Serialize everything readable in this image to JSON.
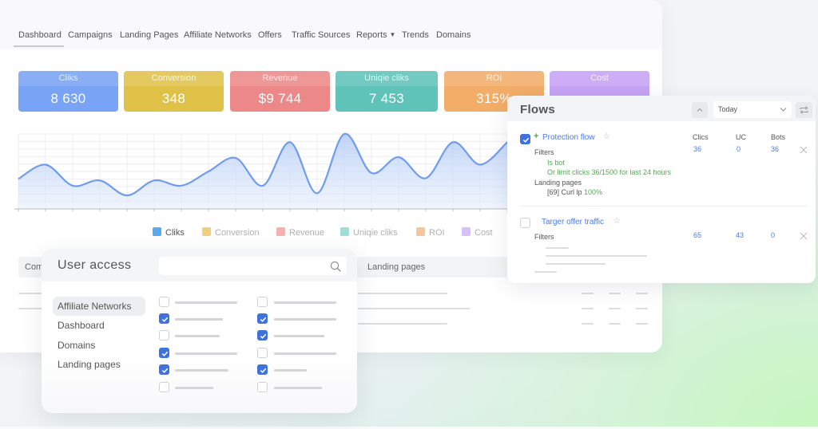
{
  "nav": {
    "items": [
      {
        "label": "Dashboard",
        "active": true
      },
      {
        "label": "Campaigns"
      },
      {
        "label": "Landing Pages"
      },
      {
        "label": "Affiliate Networks"
      },
      {
        "label": "Offers"
      },
      {
        "label": "Traffic Sources"
      },
      {
        "label": "Reports",
        "has_dropdown": true
      },
      {
        "label": "Trends"
      },
      {
        "label": "Domains"
      }
    ],
    "dropdown_caret": "▼"
  },
  "cards": [
    {
      "label": "Cliks",
      "value": "8 630",
      "color": "#79a3f4"
    },
    {
      "label": "Conversion",
      "value": "348",
      "color": "#dfc148"
    },
    {
      "label": "Revenue",
      "value": "$9 744",
      "color": "#ec8888"
    },
    {
      "label": "Uniqie cliks",
      "value": "7 453",
      "color": "#5fc3b9"
    },
    {
      "label": "ROI",
      "value": "315%",
      "color": "#f2ad68"
    },
    {
      "label": "Cost",
      "value": "",
      "color": "#c6a3f5"
    }
  ],
  "chart_data": {
    "type": "area",
    "title": "",
    "xlabel": "",
    "ylabel": "",
    "x": [
      1,
      2,
      3,
      4,
      5,
      6,
      7,
      8,
      9,
      10,
      11,
      12,
      13,
      14,
      15,
      16,
      17,
      18,
      19
    ],
    "series": [
      {
        "name": "Cliks",
        "values": [
          4.0,
          5.9,
          3.1,
          3.8,
          1.8,
          3.8,
          3.1,
          5.0,
          6.8,
          3.1,
          8.9,
          2.1,
          10.0,
          4.8,
          6.9,
          4.1,
          8.9,
          5.9,
          8.9
        ]
      }
    ],
    "ylim": [
      0,
      10
    ],
    "grid": true,
    "line_color": "#6f9cf0",
    "legend_position": "bottom",
    "legend": [
      {
        "name": "Cliks",
        "color": "#5aa9ef",
        "active": true
      },
      {
        "name": "Conversion",
        "color": "#f0cf7c",
        "active": false
      },
      {
        "name": "Revenue",
        "color": "#f4b1af",
        "active": false
      },
      {
        "name": "Uniqie cliks",
        "color": "#a2dcd6",
        "active": false
      },
      {
        "name": "ROI",
        "color": "#f5c69c",
        "active": false
      },
      {
        "name": "Cost",
        "color": "#d5c2f7",
        "active": false
      }
    ]
  },
  "table": {
    "headers": [
      "Com",
      "Landing pages"
    ]
  },
  "user_access": {
    "title": "User access",
    "search_value": "",
    "search_placeholder": "",
    "menu": [
      {
        "label": "Affiliate Networks",
        "selected": true
      },
      {
        "label": "Dashboard"
      },
      {
        "label": "Domains"
      },
      {
        "label": "Landing pages"
      }
    ],
    "permissions_col1": [
      false,
      true,
      false,
      true,
      true,
      false
    ],
    "permissions_col2": [
      false,
      true,
      true,
      false,
      true,
      false
    ]
  },
  "flows": {
    "title": "Flows",
    "period": "Today",
    "columns": [
      "Clics",
      "UC",
      "Bots"
    ],
    "rows": [
      {
        "checked": true,
        "name": "Protection flow",
        "is_new": true,
        "clics": "36",
        "uc": "0",
        "bots": "36",
        "filters_label": "Filters",
        "filters": [
          "Is bot",
          "Or limit clicks 36/1500 for last 24 hours"
        ],
        "landing_label": "Landing pages",
        "landing": "[69] Curl lp",
        "landing_share": "100%"
      },
      {
        "checked": false,
        "name": "Targer offer traffic",
        "clics": "65",
        "uc": "43",
        "bots": "0",
        "filters_label": "Filters"
      }
    ]
  }
}
